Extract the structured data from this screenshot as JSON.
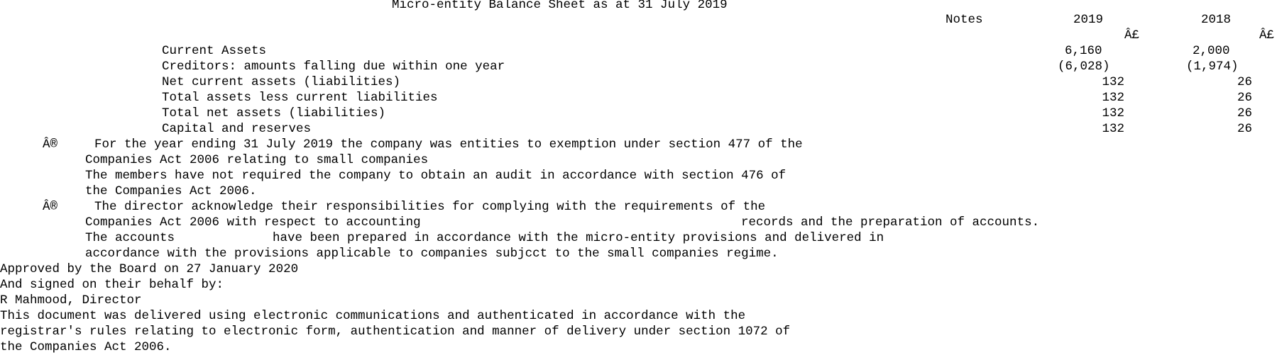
{
  "title": "Micro-entity Balance Sheet as at 31 July 2019",
  "header": {
    "notes": "Notes",
    "year_current": "2019",
    "year_prior": "2018",
    "currency_current": "Â£",
    "currency_prior": "Â£"
  },
  "rows": [
    {
      "label": "Current Assets",
      "current": "6,160",
      "prior": "2,000"
    },
    {
      "label": "Creditors: amounts falling due within one year",
      "current": "(6,028)",
      "prior": "(1,974)"
    },
    {
      "label": "Net current assets (liabilities)",
      "current": "132",
      "prior": "26"
    },
    {
      "label": "Total assets less current liabilities",
      "current": "132",
      "prior": "26"
    },
    {
      "label": "Total net assets (liabilities)",
      "current": "132",
      "prior": "26"
    },
    {
      "label": "Capital and reserves",
      "current": "132",
      "prior": "26"
    }
  ],
  "statements": {
    "bullet": "Â®",
    "s1_line1": "For the year ending 31 July 2019 the company was entities to exemption under section 477 of the",
    "s1_line2": "Companies Act 2006 relating to small companies",
    "s1_line3": "The members have not required the company to obtain an audit in accordance with section 476 of",
    "s1_line4": "the Companies Act 2006.",
    "s2_line1": "The director acknowledge their responsibilities for complying with the requirements of the",
    "s2_line2a": "Companies Act 2006 with respect to accounting",
    "s2_line2b": "records and the preparation of accounts.",
    "s2_line3a": "The accounts",
    "s2_line3b": "have been prepared in accordance with the micro-entity provisions and delivered in",
    "s2_line4": "accordance with the provisions applicable to companies subjcct to the small companies regime."
  },
  "approval": {
    "line1": "Approved by the Board on 27 January 2020",
    "line2": "And signed on their behalf by:",
    "line3": "R Mahmood, Director"
  },
  "delivery": {
    "line1": "This document was delivered using electronic communications and authenticated in accordance with the",
    "line2": "registrar's rules relating to electronic form, authentication and manner of delivery under section 1072 of",
    "line3": "the Companies Act 2006."
  }
}
